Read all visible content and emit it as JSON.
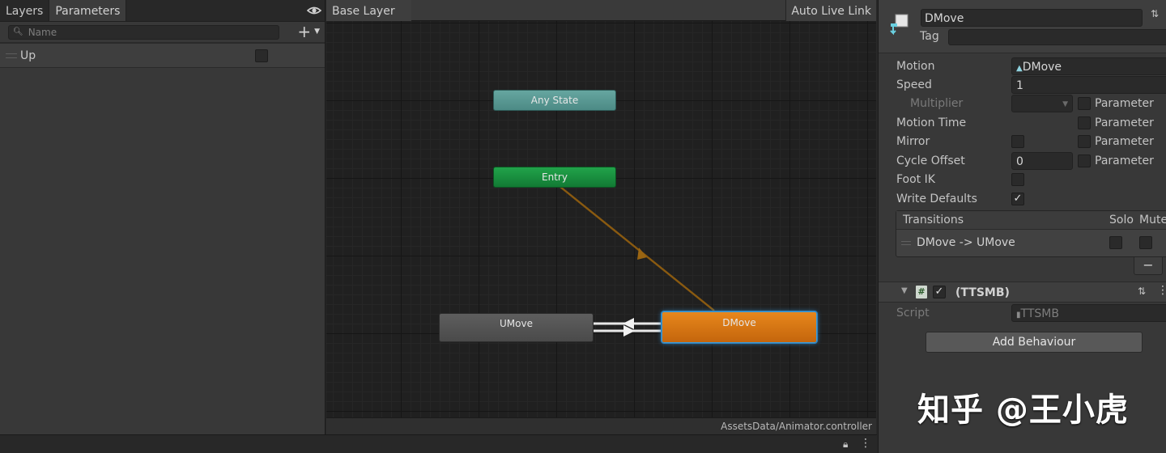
{
  "left_panel": {
    "tabs": [
      "Layers",
      "Parameters"
    ],
    "search_placeholder": "Name",
    "params": [
      {
        "name": "Up",
        "type": "bool",
        "value": false
      }
    ]
  },
  "graph": {
    "breadcrumb": "Base Layer",
    "live_link_label": "Auto Live Link",
    "footer_path": "AssetsData/Animator.controller",
    "nodes": {
      "any_state": "Any State",
      "entry": "Entry",
      "umove": "UMove",
      "dmove": "DMove"
    },
    "colors": {
      "any_state": "#5a9a95",
      "entry": "#1a8e3f",
      "umove": "#555555",
      "dmove": "#d67614",
      "selected_outline": "#3b9bd9",
      "default_transition": "#8a5a10"
    }
  },
  "inspector": {
    "state_name": "DMove",
    "tag_label": "Tag",
    "tag_value": "",
    "motion_label": "Motion",
    "motion_value": "DMove",
    "speed_label": "Speed",
    "speed_value": "1",
    "multiplier_label": "Multiplier",
    "motion_time_label": "Motion Time",
    "mirror_label": "Mirror",
    "cycle_offset_label": "Cycle Offset",
    "cycle_offset_value": "0",
    "foot_ik_label": "Foot IK",
    "write_defaults_label": "Write Defaults",
    "write_defaults_checked": true,
    "parameter_label": "Parameter",
    "transitions": {
      "header": "Transitions",
      "solo": "Solo",
      "mute": "Mute",
      "rows": [
        {
          "name": "DMove -> UMove",
          "solo": false,
          "mute": false
        }
      ]
    },
    "remove_label": "−",
    "behaviour": {
      "title": "(TTSMB)",
      "enabled": true,
      "script_label": "Script",
      "script_value": "TTSMB"
    },
    "add_behaviour_label": "Add Behaviour"
  },
  "watermark": "知乎 @王小虎"
}
